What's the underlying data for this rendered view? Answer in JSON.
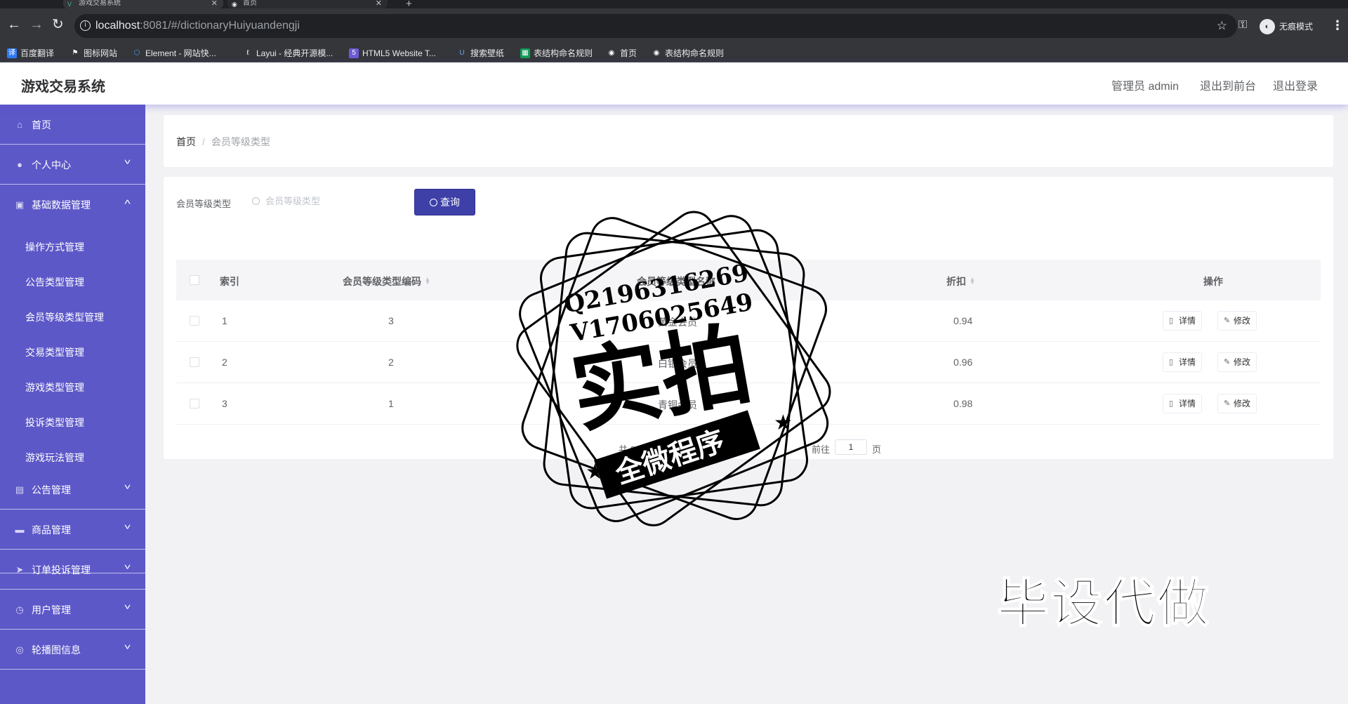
{
  "browser": {
    "tabs": [
      {
        "title": "游戏交易系统",
        "favicon": "vue-logo"
      },
      {
        "title": "首页",
        "favicon": "globe-icon"
      }
    ],
    "url_host": "localhost",
    "url_path": ":8081/#/dictionaryHuiyuandengji",
    "incognito_label": "无痕模式",
    "bookmarks": [
      {
        "label": "百度翻译",
        "icon": "translate-icon",
        "color": "#2f7bf6"
      },
      {
        "label": "图标网站",
        "icon": "flag-icon",
        "color": "#ffffff"
      },
      {
        "label": "Element - 网站快...",
        "icon": "element-icon",
        "color": "#409eff"
      },
      {
        "label": "Layui - 经典开源模...",
        "icon": "layui-icon",
        "color": "#ffffff"
      },
      {
        "label": "HTML5 Website T...",
        "icon": "html5-icon",
        "color": "#6b5bd6"
      },
      {
        "label": "搜索壁纸",
        "icon": "wallpaper-icon",
        "color": "#2f6bd8"
      },
      {
        "label": "表结构命名规则",
        "icon": "sheet-icon",
        "color": "#0f9d58"
      },
      {
        "label": "首页",
        "icon": "globe-icon",
        "color": "#ffffff"
      },
      {
        "label": "表结构命名规则",
        "icon": "globe-icon",
        "color": "#ffffff"
      }
    ]
  },
  "header": {
    "title": "游戏交易系统",
    "admin_label": "管理员 admin",
    "to_front_label": "退出到前台",
    "logout_label": "退出登录"
  },
  "sidebar": {
    "items": [
      {
        "label": "首页",
        "icon": "home-icon",
        "expandable": false
      },
      {
        "label": "个人中心",
        "icon": "user-icon",
        "expandable": true
      },
      {
        "label": "基础数据管理",
        "icon": "database-icon",
        "expandable": true,
        "expanded": true
      },
      {
        "label": "公告管理",
        "icon": "notice-icon",
        "expandable": true
      },
      {
        "label": "商品管理",
        "icon": "goods-icon",
        "expandable": true
      },
      {
        "label": "订单投诉管理",
        "icon": "send-icon",
        "expandable": true
      },
      {
        "label": "用户管理",
        "icon": "clock-icon",
        "expandable": true
      },
      {
        "label": "轮播图信息",
        "icon": "picture-icon",
        "expandable": true
      }
    ],
    "submenu": [
      "操作方式管理",
      "公告类型管理",
      "会员等级类型管理",
      "交易类型管理",
      "游戏类型管理",
      "投诉类型管理",
      "游戏玩法管理"
    ]
  },
  "breadcrumb": {
    "home": "首页",
    "current": "会员等级类型"
  },
  "search": {
    "label": "会员等级类型",
    "placeholder": "会员等级类型",
    "button_label": "查询"
  },
  "table": {
    "columns": [
      "索引",
      "会员等级类型编码",
      "会员等级类型名称",
      "折扣",
      "操作"
    ],
    "rows": [
      {
        "index": "1",
        "code": "3",
        "name": "黄金会员",
        "discount": "0.94"
      },
      {
        "index": "2",
        "code": "2",
        "name": "白银会员",
        "discount": "0.96"
      },
      {
        "index": "3",
        "code": "1",
        "name": "青铜会员",
        "discount": "0.98"
      }
    ],
    "detail_label": "详情",
    "edit_label": "修改"
  },
  "pagination": {
    "total_text": "共 3 条",
    "goto_label": "前往",
    "page": "1",
    "page_unit": "页"
  },
  "watermark": {
    "qq": "Q2196316269",
    "wechat": "V1706025649",
    "headline": "实拍",
    "ribbon": "全微程序",
    "promo": "毕设代做"
  },
  "colors": {
    "sidebar": "#5d58c8",
    "primary_button": "#3e40a8",
    "browser_chrome": "#35363a"
  }
}
